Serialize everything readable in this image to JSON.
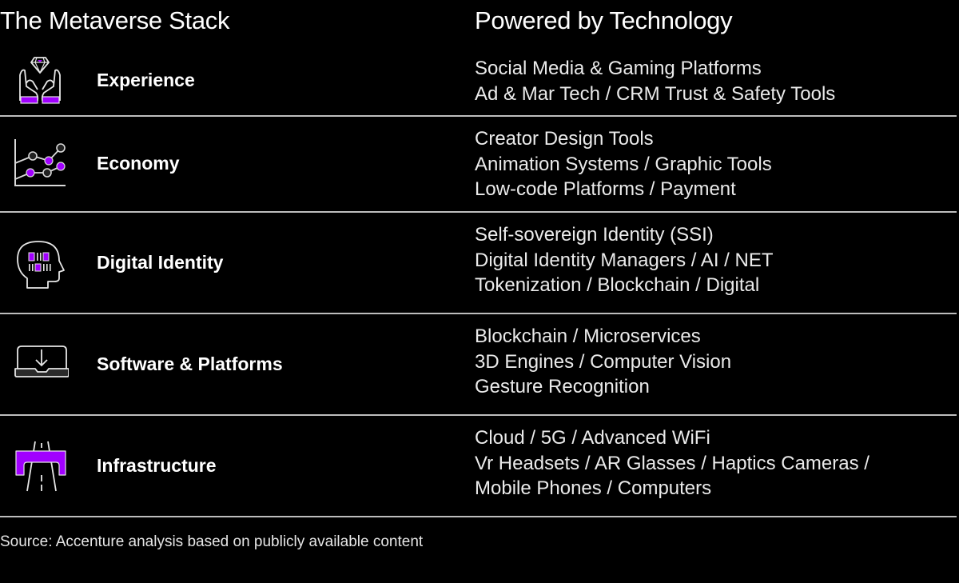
{
  "header": {
    "left_title": "The Metaverse Stack",
    "right_title": "Powered by Technology"
  },
  "colors": {
    "background": "#000000",
    "accent_purple": "#a100ff",
    "divider": "#bdbdbd",
    "text": "#ffffff"
  },
  "rows": [
    {
      "icon": "hands-holding-diamond-icon",
      "label": "Experience",
      "tech": [
        "Social Media & Gaming Platforms",
        "Ad & Mar Tech / CRM Trust & Safety Tools"
      ]
    },
    {
      "icon": "line-chart-icon",
      "label": "Economy",
      "tech": [
        "Creator Design Tools",
        "Animation Systems / Graphic Tools",
        "Low-code Platforms / Payment"
      ]
    },
    {
      "icon": "head-barcode-icon",
      "label": "Digital Identity",
      "tech": [
        "Self-sovereign Identity (SSI)",
        "Digital Identity Managers / AI / NET",
        "Tokenization / Blockchain / Digital"
      ]
    },
    {
      "icon": "laptop-download-icon",
      "label": "Software & Platforms",
      "tech": [
        "Blockchain / Microservices",
        "3D Engines / Computer Vision",
        "Gesture Recognition"
      ]
    },
    {
      "icon": "road-bridge-icon",
      "label": "Infrastructure",
      "tech": [
        "Cloud / 5G / Advanced WiFi",
        "Vr Headsets / AR Glasses / Haptics Cameras /",
        "Mobile Phones / Computers"
      ]
    }
  ],
  "footer": {
    "source": "Source: Accenture analysis based on publicly available content"
  }
}
